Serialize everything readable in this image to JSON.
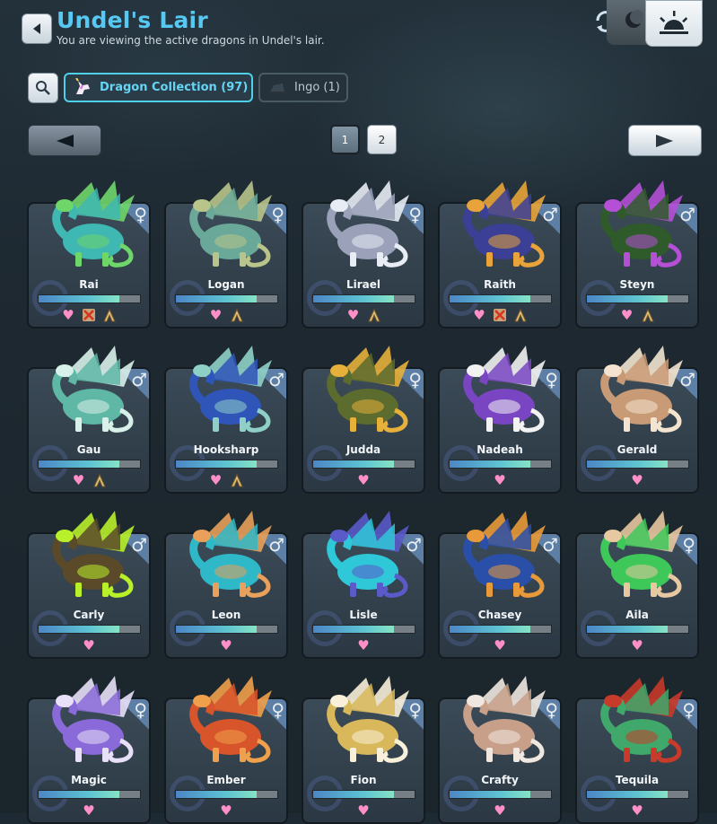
{
  "header": {
    "title": "Undel's Lair",
    "subtitle": "You are viewing the active dragons in Undel's lair."
  },
  "tabs": [
    {
      "label": "Dragon Collection (97)",
      "icon": "unicorn-icon"
    },
    {
      "label": "Ingo (1)",
      "icon": "hat-icon"
    }
  ],
  "pagination": {
    "pages": [
      "1",
      "2"
    ],
    "current": "1"
  },
  "icons": {
    "heart": "♥",
    "gene": "⋀",
    "female": "♀",
    "male": "♂",
    "no_breed": "✕"
  },
  "dragons": [
    {
      "name": "Rai",
      "gender": "♀",
      "energy": 0.8,
      "colors": [
        "#3fb7b2",
        "#6fd66a"
      ],
      "badges": [
        "heart",
        "nobreed",
        "gene"
      ]
    },
    {
      "name": "Logan",
      "gender": "♀",
      "energy": 0.8,
      "colors": [
        "#6aa99a",
        "#b8c48a"
      ],
      "badges": [
        "heart",
        "gene"
      ]
    },
    {
      "name": "Lirael",
      "gender": "♀",
      "energy": 0.8,
      "colors": [
        "#9aa1b8",
        "#e8ecf4"
      ],
      "badges": [
        "heart",
        "gene"
      ]
    },
    {
      "name": "Raith",
      "gender": "♂",
      "energy": 0.8,
      "colors": [
        "#3b3f96",
        "#e8a43a"
      ],
      "badges": [
        "heart",
        "nobreed",
        "gene"
      ]
    },
    {
      "name": "Steyn",
      "gender": "♂",
      "energy": 0.8,
      "colors": [
        "#2f5a2a",
        "#b44fd6"
      ],
      "badges": [
        "heart",
        "gene"
      ]
    },
    {
      "name": "Gau",
      "gender": "♂",
      "energy": 0.8,
      "colors": [
        "#5fb7a6",
        "#d8f0ea"
      ],
      "badges": [
        "heart",
        "gene"
      ]
    },
    {
      "name": "Hooksharp",
      "gender": "♂",
      "energy": 0.8,
      "colors": [
        "#2f55b8",
        "#8fd0c6"
      ],
      "badges": [
        "heart",
        "gene"
      ]
    },
    {
      "name": "Judda",
      "gender": "♀",
      "energy": 0.8,
      "colors": [
        "#5c6b2e",
        "#e6b03a"
      ],
      "badges": [
        "heart"
      ]
    },
    {
      "name": "Nadeah",
      "gender": "♀",
      "energy": 0.8,
      "colors": [
        "#7a45c2",
        "#f2f2f2"
      ],
      "badges": [
        "heart"
      ]
    },
    {
      "name": "Gerald",
      "gender": "♂",
      "energy": 0.8,
      "colors": [
        "#c99a76",
        "#f3e3cf"
      ],
      "badges": [
        "heart"
      ]
    },
    {
      "name": "Carly",
      "gender": "♂",
      "energy": 0.8,
      "colors": [
        "#5b4a2a",
        "#b8f02a"
      ],
      "badges": [
        "heart"
      ]
    },
    {
      "name": "Leon",
      "gender": "♂",
      "energy": 0.8,
      "colors": [
        "#2fb8c8",
        "#e8a05a"
      ],
      "badges": [
        "heart"
      ]
    },
    {
      "name": "Lisle",
      "gender": "♂",
      "energy": 0.8,
      "colors": [
        "#2fc8d8",
        "#5a5ac8"
      ],
      "badges": [
        "heart"
      ]
    },
    {
      "name": "Chasey",
      "gender": "♂",
      "energy": 0.8,
      "colors": [
        "#2a4fa8",
        "#e89a3a"
      ],
      "badges": [
        "heart"
      ]
    },
    {
      "name": "Aila",
      "gender": "♀",
      "energy": 0.8,
      "colors": [
        "#3fc85a",
        "#e8c8a0"
      ],
      "badges": [
        "heart"
      ]
    },
    {
      "name": "Magic",
      "gender": "♀",
      "energy": 0.8,
      "colors": [
        "#8a6ad8",
        "#e8e0f8"
      ],
      "badges": [
        "heart"
      ]
    },
    {
      "name": "Ember",
      "gender": "♀",
      "energy": 0.8,
      "colors": [
        "#d8542a",
        "#f0a04a"
      ],
      "badges": [
        "heart"
      ]
    },
    {
      "name": "Fion",
      "gender": "♀",
      "energy": 0.8,
      "colors": [
        "#d8b85a",
        "#f8f0d8"
      ],
      "badges": [
        "heart"
      ]
    },
    {
      "name": "Crafty",
      "gender": "♀",
      "energy": 0.8,
      "colors": [
        "#c8a08a",
        "#f0e8e0"
      ],
      "badges": [
        "heart"
      ]
    },
    {
      "name": "Tequila",
      "gender": "♀",
      "energy": 0.8,
      "colors": [
        "#3fa86a",
        "#c83a2a"
      ],
      "badges": [
        "heart"
      ]
    }
  ]
}
